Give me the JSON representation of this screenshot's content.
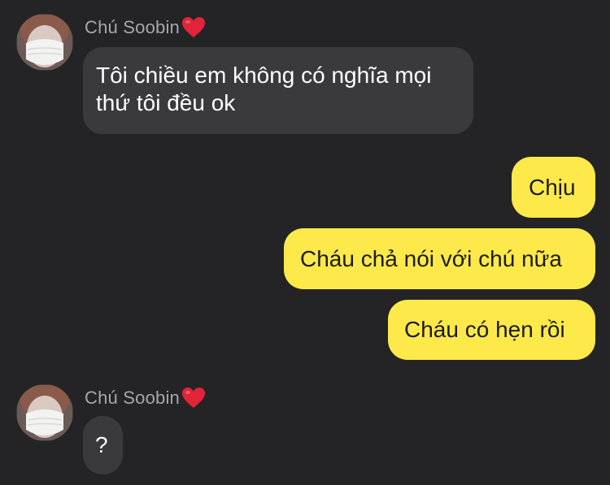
{
  "messages": [
    {
      "direction": "incoming",
      "sender": "Chú Soobin",
      "sender_emoji": "heart-emoji",
      "avatar": "avatar-masked-person",
      "text": "Tôi chiều em không có nghĩa mọi thứ tôi đều ok"
    },
    {
      "direction": "outgoing",
      "text": "Chịu"
    },
    {
      "direction": "outgoing",
      "text": "Cháu chả nói với chú nữa"
    },
    {
      "direction": "outgoing",
      "text": "Cháu có hẹn rồi"
    },
    {
      "direction": "incoming",
      "sender": "Chú Soobin",
      "sender_emoji": "heart-emoji",
      "avatar": "avatar-masked-person",
      "text": "?"
    }
  ],
  "colors": {
    "background": "#242426",
    "incoming_bubble": "#3a3a3c",
    "outgoing_bubble": "#fde94a",
    "sender_name": "#a7a7ab",
    "heart": "#e0243a"
  }
}
